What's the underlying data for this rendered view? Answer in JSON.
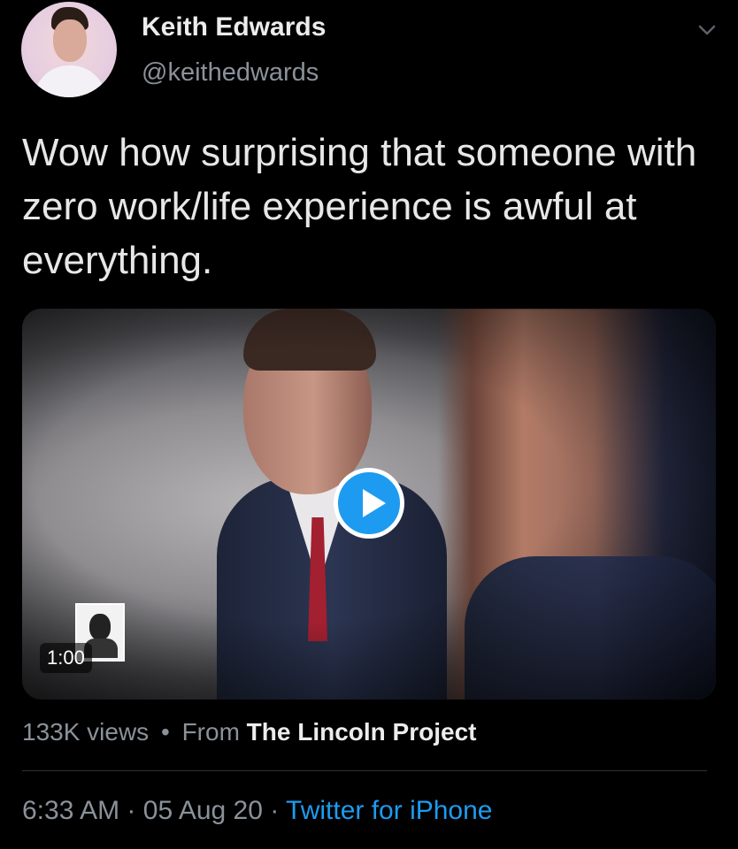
{
  "header": {
    "display_name": "Keith Edwards",
    "handle": "@keithedwards"
  },
  "tweet": {
    "text": "Wow how surprising that someone with zero work/life experience is awful at everything."
  },
  "media": {
    "duration": "1:00"
  },
  "meta": {
    "views": "133K views",
    "separator": "•",
    "from_label": "From",
    "source": "The Lincoln Project"
  },
  "footer": {
    "time": "6:33 AM",
    "sep1": "·",
    "date": "05 Aug 20",
    "sep2": "·",
    "client": "Twitter for iPhone"
  },
  "colors": {
    "background": "#000000",
    "accent": "#1d9bf0",
    "secondary_text": "#8a9199",
    "primary_text": "#e7e7e7"
  },
  "icons": [
    "avatar",
    "chevron-down-icon",
    "play-icon",
    "channel-logo"
  ]
}
